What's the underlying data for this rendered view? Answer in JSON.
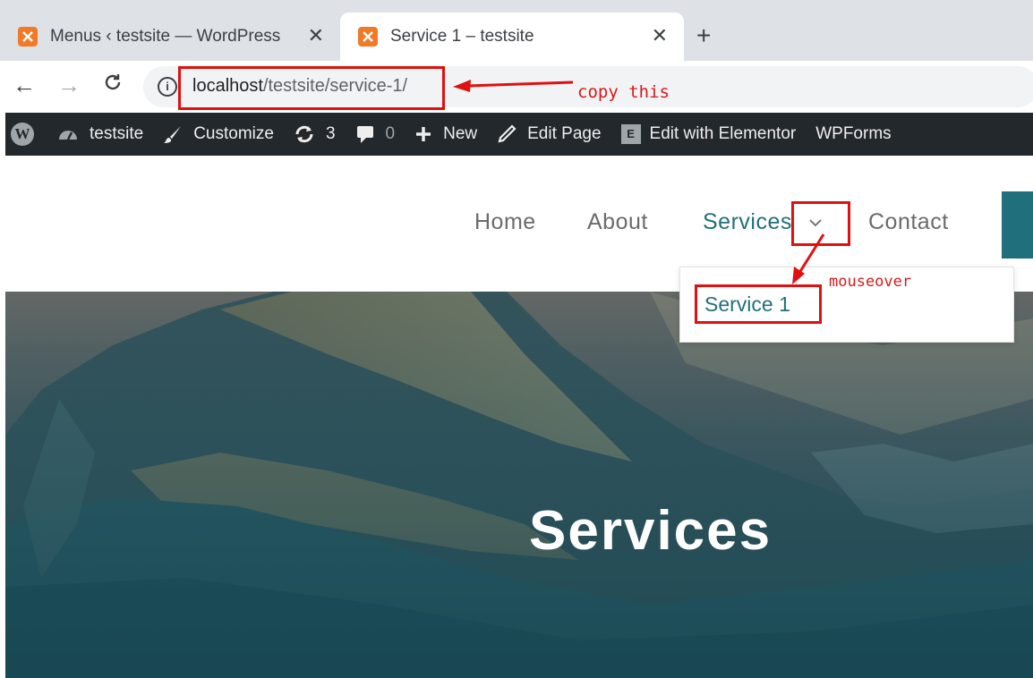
{
  "browser": {
    "tabs": [
      {
        "title": "Menus ‹ testsite — WordPress",
        "close": "✕",
        "active": false
      },
      {
        "title": "Service 1 – testsite",
        "close": "✕",
        "active": true
      }
    ],
    "new_tab": "+",
    "nav": {
      "back": "←",
      "forward": "→",
      "reload": "C"
    },
    "url_host": "localhost",
    "url_path": "/testsite/service-1/",
    "info_icon": "i"
  },
  "adminbar": {
    "wp_logo": "W",
    "site": "testsite",
    "customize": "Customize",
    "updates": "3",
    "comments": "0",
    "new": "New",
    "edit_page": "Edit Page",
    "elementor_icon": "E",
    "elementor": "Edit with Elementor",
    "wpforms": "WPForms"
  },
  "site_menu": {
    "home": "Home",
    "about": "About",
    "services": "Services",
    "contact": "Contact"
  },
  "dropdown": {
    "items": [
      "Service 1"
    ]
  },
  "hero": {
    "title": "Services"
  },
  "annotations": {
    "copy_note": "copy this",
    "mouseover_note": "mouseover"
  },
  "colors": {
    "accent": "#22707a",
    "annotation_red": "#e01010",
    "adminbar_bg": "#23282d",
    "tab_favicon": "#f07a28"
  }
}
